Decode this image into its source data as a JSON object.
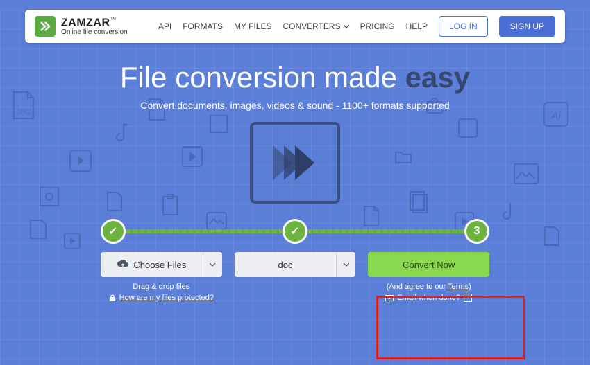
{
  "brand": {
    "name": "ZAMZAR",
    "tm": "™",
    "tagline": "Online file conversion"
  },
  "nav": {
    "api": "API",
    "formats": "FORMATS",
    "myfiles": "MY FILES",
    "converters": "CONVERTERS",
    "pricing": "PRICING",
    "help": "HELP",
    "login": "LOG IN",
    "signup": "SIGN UP"
  },
  "hero": {
    "title_prefix": "File conversion made ",
    "title_em": "easy",
    "subtitle": "Convert documents, images, videos & sound - 1100+ formats supported"
  },
  "steps": {
    "s1": "✓",
    "s2": "✓",
    "s3": "3"
  },
  "choose": {
    "label": "Choose Files",
    "sub1": "Drag & drop files",
    "sub2": "How are my files protected?"
  },
  "format": {
    "selected": "doc"
  },
  "convert": {
    "label": "Convert Now",
    "agree_pre": "(And agree to our ",
    "agree_link": "Terms",
    "agree_post": ")",
    "email_label": "Email when done?"
  }
}
